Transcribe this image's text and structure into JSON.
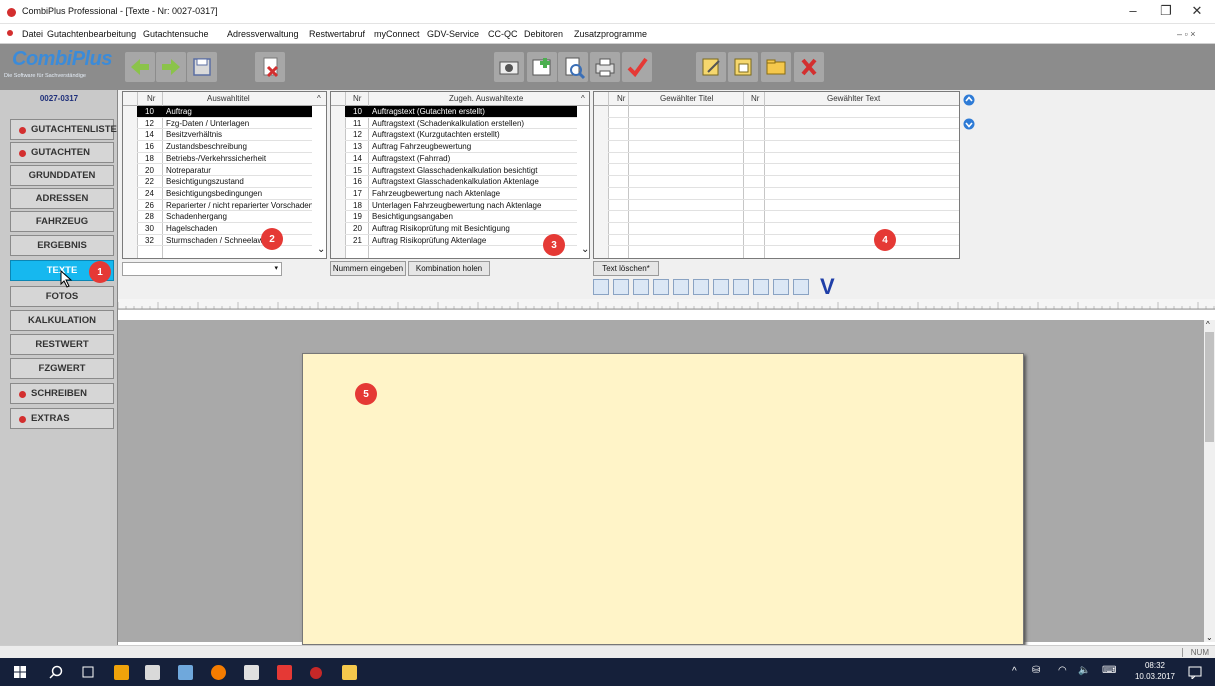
{
  "window": {
    "title": "CombiPlus Professional - [Texte - Nr: 0027-0317]"
  },
  "menu": [
    "Datei",
    "Gutachtenbearbeitung",
    "Gutachtensuche",
    "Adressverwaltung",
    "Restwertabruf",
    "myConnect",
    "GDV-Service",
    "CC-QC",
    "Debitoren",
    "Zusatzprogramme"
  ],
  "logo": {
    "name": "CombiPlus",
    "tagline": "Die Software für Sachverständige"
  },
  "sidebar": {
    "reg_nr": "0027-0317",
    "items": [
      {
        "label": "GUTACHTENLISTE"
      },
      {
        "label": "GUTACHTEN"
      },
      {
        "label": "GRUNDDATEN"
      },
      {
        "label": "ADRESSEN"
      },
      {
        "label": "FAHRZEUG"
      },
      {
        "label": "ERGEBNIS"
      },
      {
        "label": "TEXTE"
      },
      {
        "label": "FOTOS"
      },
      {
        "label": "KALKULATION"
      },
      {
        "label": "RESTWERT"
      },
      {
        "label": "FZGWERT"
      },
      {
        "label": "SCHREIBEN"
      },
      {
        "label": "EXTRAS"
      }
    ]
  },
  "grid1": {
    "headers": [
      "Nr",
      "Auswahltitel"
    ],
    "rows": [
      {
        "nr": "10",
        "text": "Auftrag"
      },
      {
        "nr": "12",
        "text": "Fzg-Daten / Unterlagen"
      },
      {
        "nr": "14",
        "text": "Besitzverhältnis"
      },
      {
        "nr": "16",
        "text": "Zustandsbeschreibung"
      },
      {
        "nr": "18",
        "text": "Betriebs-/Verkehrssicherheit"
      },
      {
        "nr": "20",
        "text": "Notreparatur"
      },
      {
        "nr": "22",
        "text": "Besichtigungszustand"
      },
      {
        "nr": "24",
        "text": "Besichtigungsbedingungen"
      },
      {
        "nr": "26",
        "text": "Reparierter / nicht reparierter Vorschaden"
      },
      {
        "nr": "28",
        "text": "Schadenhergang"
      },
      {
        "nr": "30",
        "text": "Hagelschaden"
      },
      {
        "nr": "32",
        "text": "Sturmschaden / Schneelawine"
      }
    ]
  },
  "grid2": {
    "headers": [
      "Nr",
      "Zugeh. Auswahltexte"
    ],
    "rows": [
      {
        "nr": "10",
        "text": "Auftragstext (Gutachten erstellt)"
      },
      {
        "nr": "11",
        "text": "Auftragstext (Schadenkalkulation erstellen)"
      },
      {
        "nr": "12",
        "text": "Auftragstext (Kurzgutachten erstellt)"
      },
      {
        "nr": "13",
        "text": "Auftrag Fahrzeugbewertung"
      },
      {
        "nr": "14",
        "text": "Auftragstext (Fahrrad)"
      },
      {
        "nr": "15",
        "text": "Auftragstext Glasschadenkalkulation besichtigt"
      },
      {
        "nr": "16",
        "text": "Auftragstext Glasschadenkalkulation Aktenlage"
      },
      {
        "nr": "17",
        "text": "Fahrzeugbewertung nach Aktenlage"
      },
      {
        "nr": "18",
        "text": "Unterlagen Fahrzeugbewertung nach Aktenlage"
      },
      {
        "nr": "19",
        "text": "Besichtigungsangaben"
      },
      {
        "nr": "20",
        "text": "Auftrag Risikoprüfung mit Besichtigung"
      },
      {
        "nr": "21",
        "text": "Auftrag Risikoprüfung Aktenlage"
      }
    ]
  },
  "grid3": {
    "headers": [
      "Nr",
      "Gewählter Titel",
      "Nr",
      "Gewählter Text"
    ]
  },
  "buttons": {
    "nummern": "Nummern eingeben",
    "kombination": "Kombination holen",
    "text_loeschen": "Text löschen*"
  },
  "badges": [
    "1",
    "2",
    "3",
    "4",
    "5"
  ],
  "status": {
    "num": "NUM"
  },
  "clock": {
    "time": "08:32",
    "date": "10.03.2017"
  }
}
